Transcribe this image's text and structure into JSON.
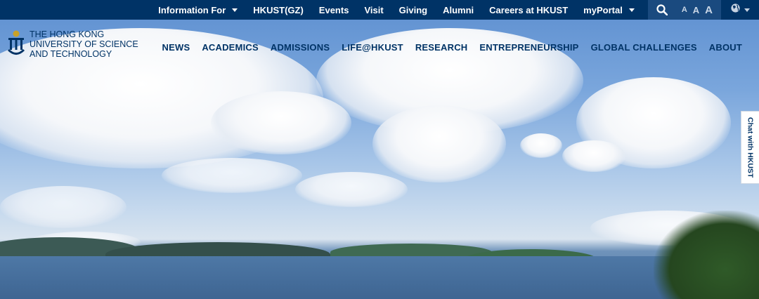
{
  "topbar": {
    "items": [
      {
        "label": "Information For",
        "dropdown": true
      },
      {
        "label": "HKUST(GZ)",
        "dropdown": false
      },
      {
        "label": "Events",
        "dropdown": false
      },
      {
        "label": "Visit",
        "dropdown": false
      },
      {
        "label": "Giving",
        "dropdown": false
      },
      {
        "label": "Alumni",
        "dropdown": false
      },
      {
        "label": "Careers at HKUST",
        "dropdown": false
      },
      {
        "label": "myPortal",
        "dropdown": true
      }
    ],
    "font_sizes": [
      "A",
      "A",
      "A"
    ],
    "icons": {
      "search": "search-icon",
      "language": "globe-icon",
      "dropdown": "chevron-down-icon"
    }
  },
  "logo": {
    "lines": [
      "The Hong Kong",
      "University of Science",
      "and Technology"
    ],
    "icon": "hkust-crest-icon"
  },
  "mainnav": {
    "items": [
      "NEWS",
      "ACADEMICS",
      "ADMISSIONS",
      "LIFE@HKUST",
      "RESEARCH",
      "ENTREPRENEURSHIP",
      "GLOBAL CHALLENGES",
      "ABOUT"
    ]
  },
  "chat": {
    "label": "Chat with HKUST"
  },
  "colors": {
    "brand": "#003366",
    "tools_bg": "#1a4a7f",
    "gold": "#c9a227"
  }
}
